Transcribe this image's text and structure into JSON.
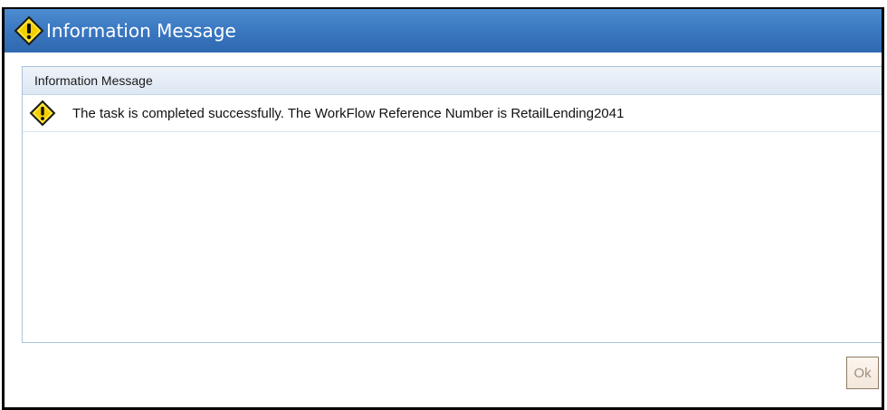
{
  "dialog": {
    "title": "Information Message",
    "title_icon": "warning-icon",
    "colors": {
      "titlebar": "#3b79c2",
      "title_text": "#ffffff",
      "panel_border": "#a9c3de",
      "icon_fill": "#f4d000"
    }
  },
  "panel": {
    "header": "Information Message",
    "messages": [
      {
        "icon": "warning-icon",
        "text": "The task is completed successfully. The WorkFlow Reference Number is RetailLending2041"
      }
    ]
  },
  "buttons": {
    "ok_label": "Ok"
  }
}
